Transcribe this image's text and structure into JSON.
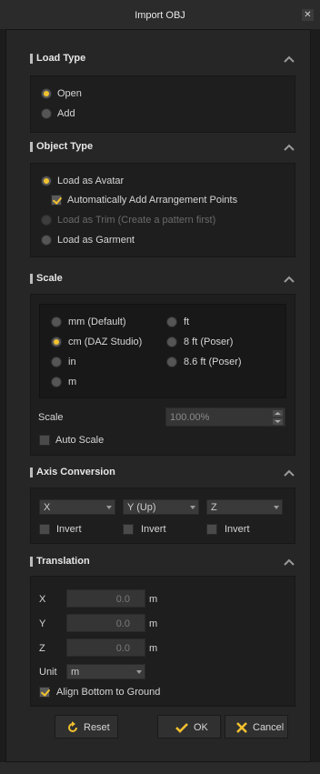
{
  "window": {
    "title": "Import OBJ",
    "close_icon": "close-icon"
  },
  "load_type": {
    "header": "Load Type",
    "options": [
      {
        "label": "Open",
        "selected": true
      },
      {
        "label": "Add",
        "selected": false
      }
    ]
  },
  "object_type": {
    "header": "Object Type",
    "avatar_label": "Load as Avatar",
    "auto_arrange_label": "Automatically Add Arrangement Points",
    "trim_label": "Load as Trim (Create a pattern first)",
    "garment_label": "Load as Garment"
  },
  "scale": {
    "header": "Scale",
    "units_left": [
      "mm (Default)",
      "cm (DAZ Studio)",
      "in",
      "m"
    ],
    "units_right": [
      "ft",
      "8 ft (Poser)",
      "8.6 ft (Poser)"
    ],
    "selected": "cm (DAZ Studio)",
    "scale_label": "Scale",
    "scale_value": "100.00%",
    "auto_scale_label": "Auto Scale"
  },
  "axis_conversion": {
    "header": "Axis Conversion",
    "axes": [
      {
        "value": "X",
        "invert_label": "Invert"
      },
      {
        "value": "Y (Up)",
        "invert_label": "Invert"
      },
      {
        "value": "Z",
        "invert_label": "Invert"
      }
    ]
  },
  "translation": {
    "header": "Translation",
    "rows": [
      {
        "axis": "X",
        "value": "0.0",
        "unit": "m"
      },
      {
        "axis": "Y",
        "value": "0.0",
        "unit": "m"
      },
      {
        "axis": "Z",
        "value": "0.0",
        "unit": "m"
      }
    ],
    "unit_label": "Unit",
    "unit_value": "m",
    "align_label": "Align Bottom to Ground"
  },
  "buttons": {
    "reset": "Reset",
    "ok": "OK",
    "cancel": "Cancel"
  },
  "colors": {
    "accent": "#f2c12e",
    "panel": "#1e1e1e",
    "background": "#262626"
  }
}
